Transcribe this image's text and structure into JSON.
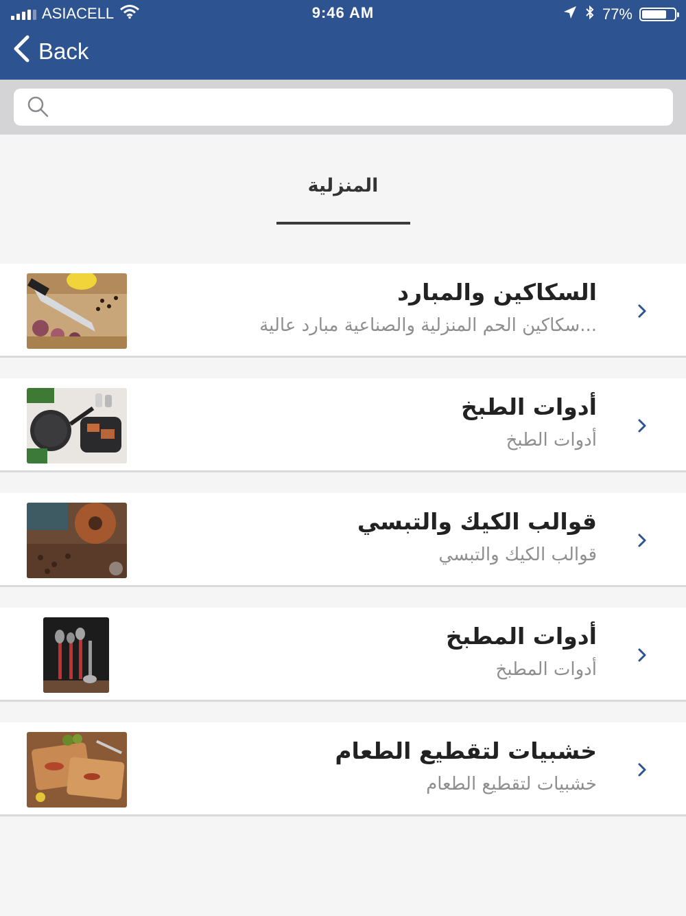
{
  "status_bar": {
    "carrier": "ASIACELL",
    "time": "9:46 AM",
    "battery_percent": "77%",
    "battery_level": 0.77
  },
  "nav": {
    "back_label": "Back"
  },
  "search": {
    "placeholder": ""
  },
  "section": {
    "title": "المنزلية"
  },
  "items": [
    {
      "title": "السكاكين والمبارد",
      "subtitle": "...سكاكين الحم المنزلية والصناعية مبارد عالية"
    },
    {
      "title": "أدوات الطبخ",
      "subtitle": "أدوات الطبخ"
    },
    {
      "title": "قوالب الكيك والتبسي",
      "subtitle": "قوالب الكيك والتبسي"
    },
    {
      "title": "أدوات المطبخ",
      "subtitle": "أدوات المطبخ"
    },
    {
      "title": "خشبيات لتقطيع الطعام",
      "subtitle": "خشبيات لتقطيع الطعام"
    }
  ],
  "colors": {
    "nav_bar": "#2d5391",
    "search_area": "#d4d4d6",
    "background": "#f5f5f5"
  },
  "icons": [
    "signal-icon",
    "wifi-icon",
    "location-arrow-icon",
    "bluetooth-icon",
    "battery-icon",
    "back-chevron-icon",
    "search-icon",
    "chevron-right-icon"
  ]
}
